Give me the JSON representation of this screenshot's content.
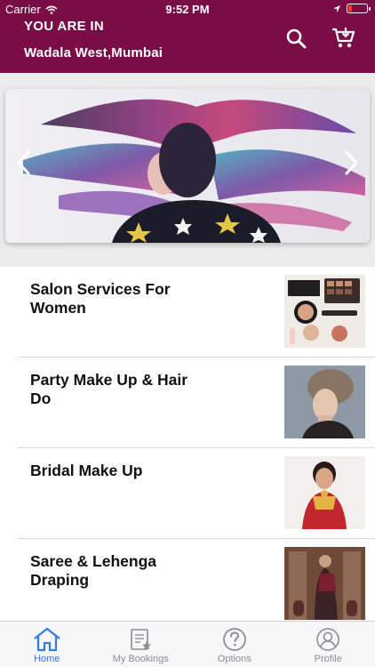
{
  "status_bar": {
    "carrier": "Carrier",
    "time": "9:52 PM"
  },
  "header": {
    "location_label": "YOU ARE IN",
    "location_value": "Wadala West,Mumbai",
    "search_icon": "search-icon",
    "cart_icon": "cart-icon"
  },
  "banner": {
    "prev_icon": "chevron-left-icon",
    "next_icon": "chevron-right-icon"
  },
  "services": [
    {
      "title": "Salon Services For Women"
    },
    {
      "title": "Party Make Up & Hair Do"
    },
    {
      "title": "Bridal Make Up"
    },
    {
      "title": "Saree & Lehenga Draping"
    }
  ],
  "tabs": [
    {
      "label": "Home",
      "icon": "home-icon",
      "active": true
    },
    {
      "label": "My Bookings",
      "icon": "bookings-icon",
      "active": false
    },
    {
      "label": "Options",
      "icon": "help-icon",
      "active": false
    },
    {
      "label": "Profile",
      "icon": "profile-icon",
      "active": false
    }
  ],
  "colors": {
    "brand": "#7a0d46",
    "active_tab": "#2f7be5",
    "inactive_tab": "#8e8e93"
  }
}
